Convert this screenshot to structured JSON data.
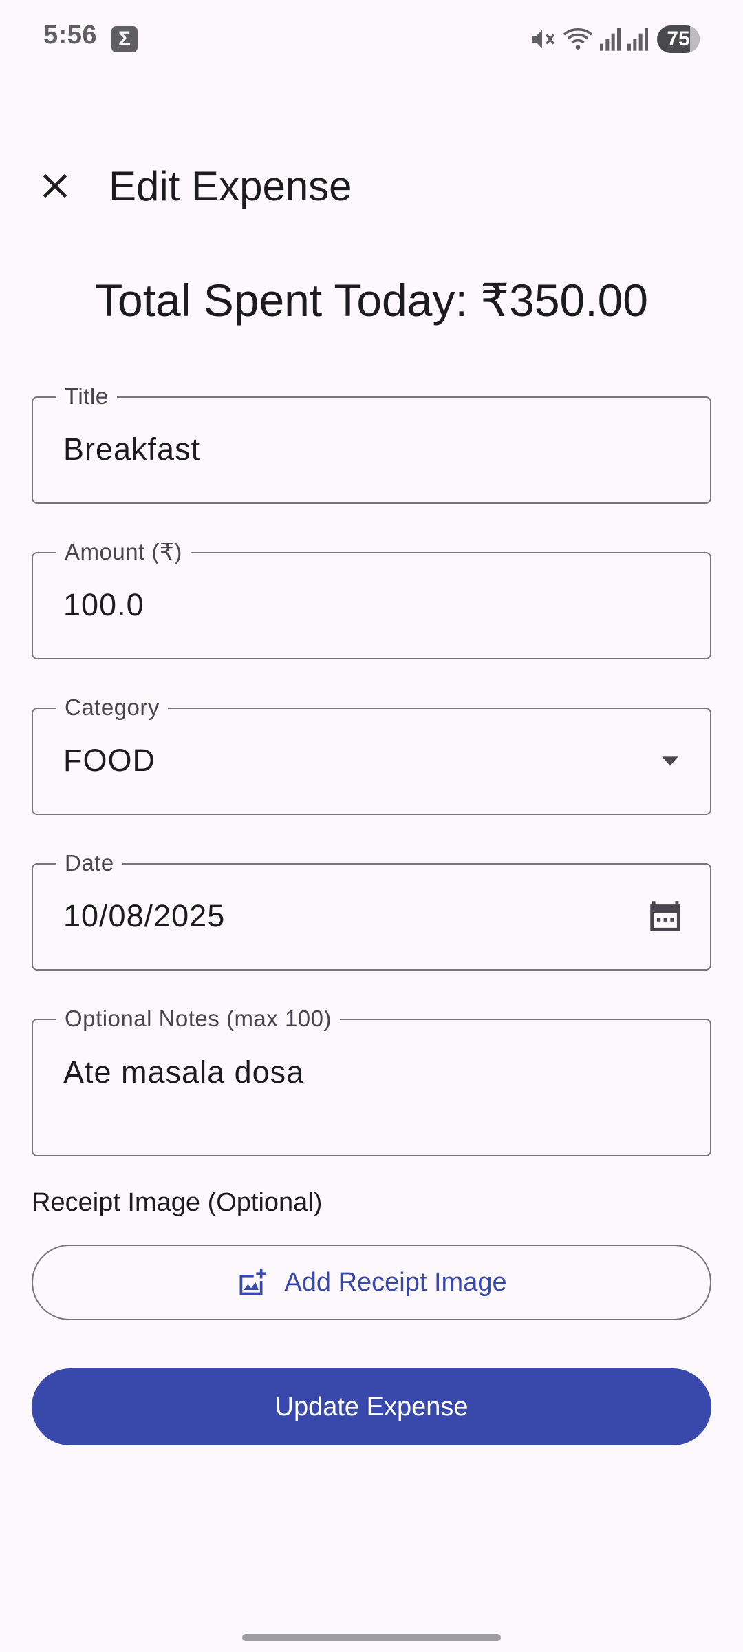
{
  "status_bar": {
    "time": "5:56",
    "badge": "Σ",
    "battery": "75"
  },
  "header": {
    "title": "Edit Expense",
    "close_icon": "close-icon"
  },
  "summary": {
    "total_text": "Total Spent Today: ₹350.00"
  },
  "form": {
    "title": {
      "label": "Title",
      "value": "Breakfast"
    },
    "amount": {
      "label": "Amount (₹)",
      "value": "100.0"
    },
    "category": {
      "label": "Category",
      "value": "FOOD",
      "icon": "dropdown-arrow-icon"
    },
    "date": {
      "label": "Date",
      "value": "10/08/2025",
      "icon": "calendar-icon"
    },
    "notes": {
      "label": "Optional Notes (max 100)",
      "value": "Ate masala dosa"
    }
  },
  "receipt": {
    "label": "Receipt Image (Optional)",
    "button_label": "Add Receipt Image",
    "icon": "add-photo-icon"
  },
  "actions": {
    "update_label": "Update Expense"
  },
  "colors": {
    "background": "#fcf8fc",
    "primary": "#3949ab",
    "outline": "#79747e",
    "on_surface": "#1c1b1f"
  }
}
